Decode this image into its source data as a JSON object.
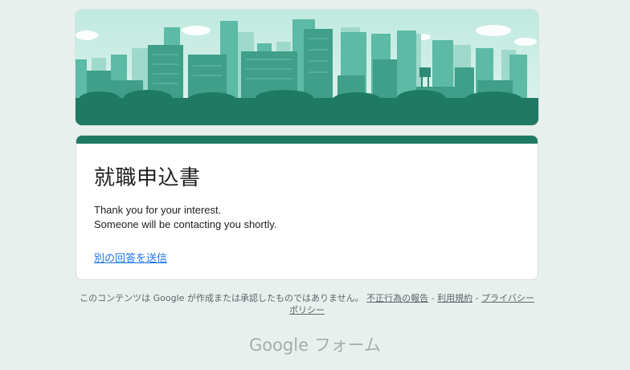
{
  "form": {
    "title": "就職申込書",
    "confirmation_line1": "Thank you for your interest.",
    "confirmation_line2": "Someone will be contacting you shortly.",
    "submit_another_label": "別の回答を送信"
  },
  "footer": {
    "disclaimer": "このコンテンツは Google が作成または承認したものではありません。",
    "report_abuse": "不正行為の報告",
    "separator": " - ",
    "terms": "利用規約",
    "privacy": "プライバシー ポリシー"
  },
  "brand": {
    "google": "Google",
    "forms": "フォーム"
  },
  "colors": {
    "accent": "#1f7a63",
    "background": "#e8f0ee",
    "link": "#1a73e8"
  },
  "banner": {
    "image": "city-skyline-illustration"
  }
}
